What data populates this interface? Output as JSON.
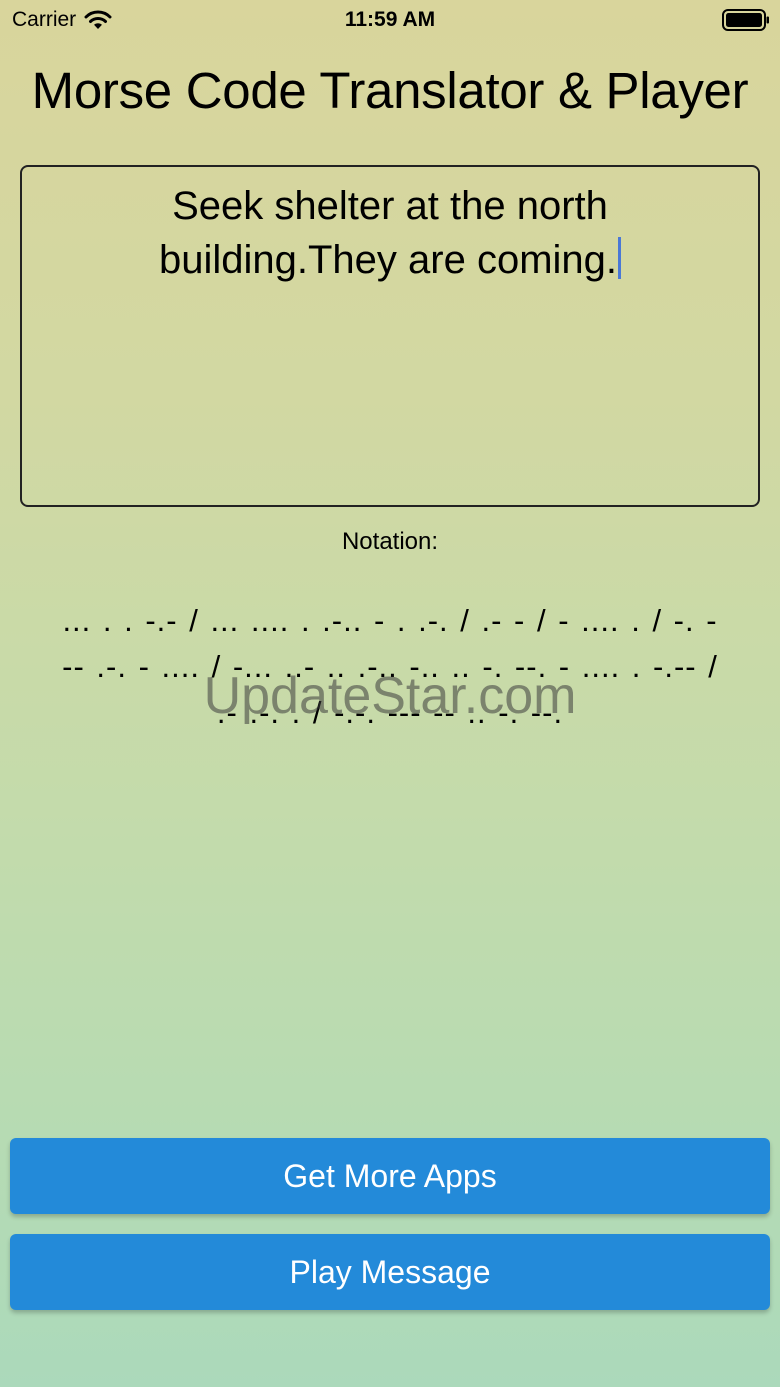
{
  "status_bar": {
    "carrier": "Carrier",
    "time": "11:59 AM",
    "wifi_icon": "wifi-icon",
    "battery_icon": "battery-full-icon"
  },
  "app": {
    "title": "Morse Code Translator & Player"
  },
  "input": {
    "value": "Seek shelter at the north building.They are coming."
  },
  "notation": {
    "label": "Notation:",
    "morse": "... . . -.- / ... .... . .-.. - . .-. / .- - / - .... . / -. --- .-. - .... / -... ..- .. .-.. -.. .. -. --. - .... . -.-- / .- .-. . / -.-. --- -- .. -. --."
  },
  "watermark": "UpdateStar.com",
  "buttons": {
    "get_more_apps": "Get More Apps",
    "play_message": "Play Message"
  },
  "colors": {
    "button_bg": "#238ad9",
    "cursor": "#4a78d6"
  }
}
